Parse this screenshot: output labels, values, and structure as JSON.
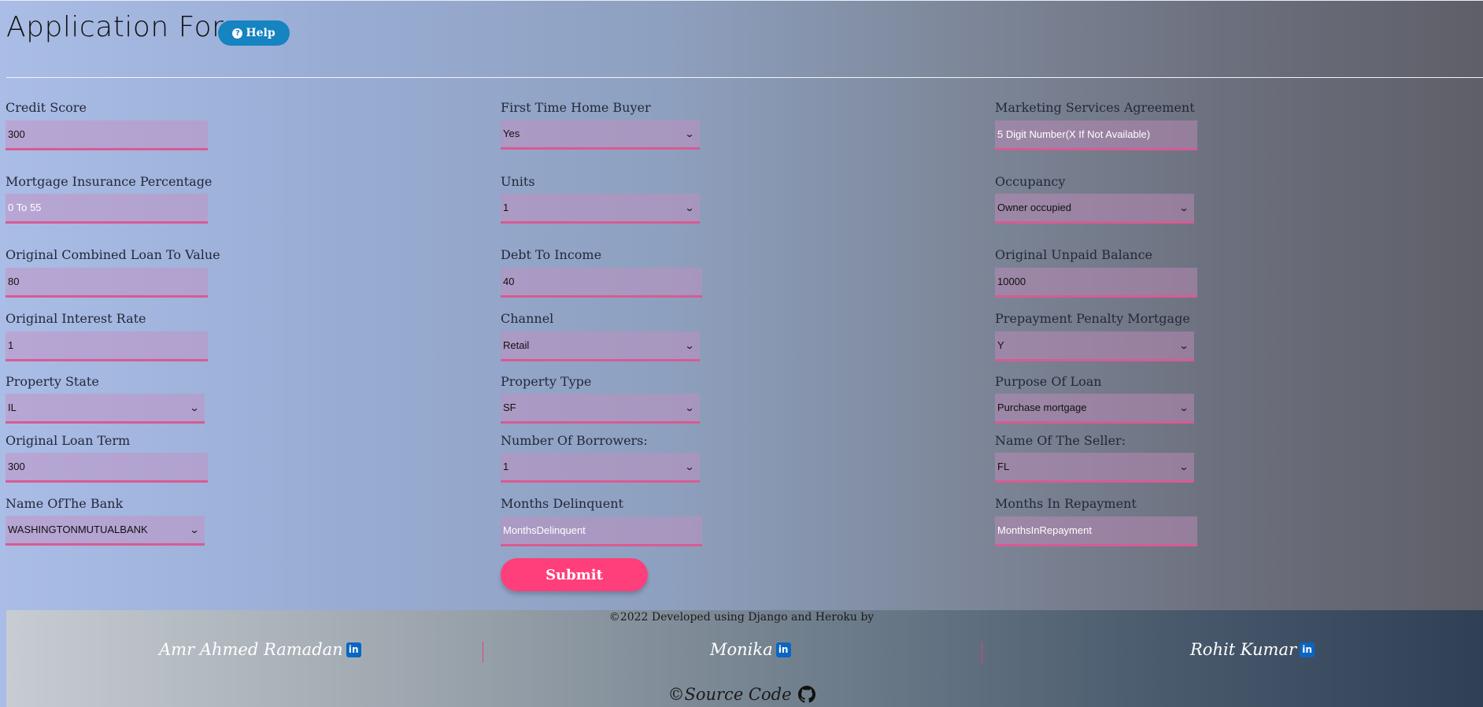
{
  "header": {
    "title": "Application Form",
    "help_label": "Help"
  },
  "form": {
    "credit_score": {
      "label": "Credit Score",
      "value": "300"
    },
    "first_time_home_buyer": {
      "label": "First Time Home Buyer",
      "value": "Yes"
    },
    "marketing_services_agreement": {
      "label": "Marketing Services Agreement",
      "placeholder": "5 Digit Number(X If Not Available)"
    },
    "mortgage_insurance_percentage": {
      "label": "Mortgage Insurance Percentage",
      "placeholder": "0 To 55"
    },
    "units": {
      "label": "Units",
      "value": "1"
    },
    "occupancy": {
      "label": "Occupancy",
      "value": "Owner occupied"
    },
    "original_cltv": {
      "label": "Original Combined Loan To Value",
      "value": "80"
    },
    "debt_to_income": {
      "label": "Debt To Income",
      "value": "40"
    },
    "original_unpaid_balance": {
      "label": "Original Unpaid Balance",
      "value": "10000"
    },
    "original_interest_rate": {
      "label": "Original Interest Rate",
      "value": "1"
    },
    "channel": {
      "label": "Channel",
      "value": "Retail"
    },
    "prepayment_penalty_mortgage": {
      "label": "Prepayment Penalty Mortgage",
      "value": "Y"
    },
    "property_state": {
      "label": "Property State",
      "value": "IL"
    },
    "property_type": {
      "label": "Property Type",
      "value": "SF"
    },
    "purpose_of_loan": {
      "label": "Purpose Of Loan",
      "value": "Purchase mortgage"
    },
    "original_loan_term": {
      "label": "Original Loan Term",
      "value": "300"
    },
    "number_of_borrowers": {
      "label": "Number Of Borrowers:",
      "value": "1"
    },
    "name_of_seller": {
      "label": "Name Of The Seller:",
      "value": "FL"
    },
    "name_of_bank": {
      "label": "Name OfThe Bank",
      "value": "WASHINGTONMUTUALBANK"
    },
    "months_delinquent": {
      "label": "Months Delinquent",
      "placeholder": "MonthsDelinquent"
    },
    "months_in_repayment": {
      "label": "Months In Repayment",
      "placeholder": "MonthsInRepayment"
    },
    "submit_label": "Submit"
  },
  "footer": {
    "credit": "©2022 Developed using Django and Heroku by",
    "authors": [
      "Amr Ahmed Ramadan",
      "Monika",
      "Rohit Kumar"
    ],
    "linkedin_icon_text": "in",
    "source_code": "©Source Code"
  },
  "colors": {
    "accent": "#ff3f7c",
    "help_button": "#1584c0",
    "field_underline": "#d85b93",
    "linkedin": "#0a66c2"
  },
  "icons": [
    "question-circle-icon",
    "linkedin-icon",
    "github-icon",
    "chevron-down-icon"
  ]
}
